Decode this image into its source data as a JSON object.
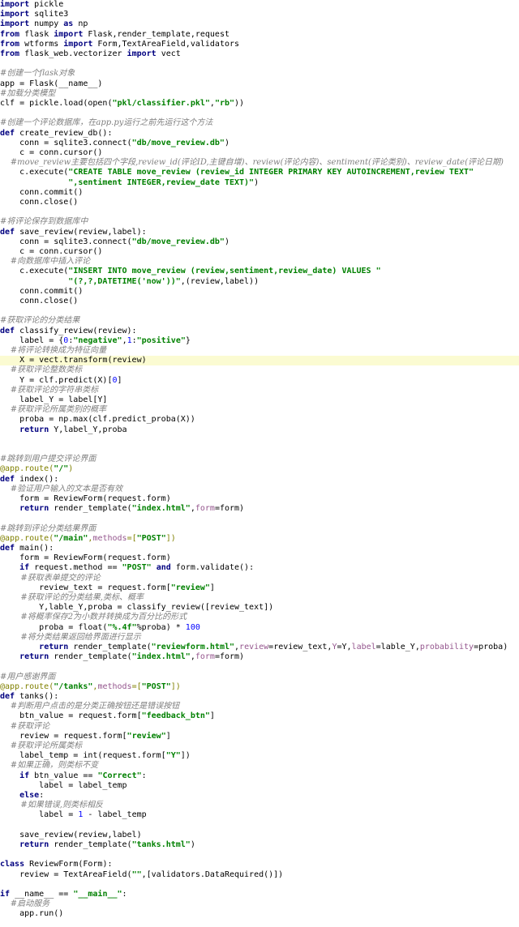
{
  "editor": {
    "highlighted_line_index": 36,
    "lines": [
      [
        [
          "k",
          "import"
        ],
        [
          "t",
          " pickle"
        ]
      ],
      [
        [
          "k",
          "import"
        ],
        [
          "t",
          " sqlite3"
        ]
      ],
      [
        [
          "k",
          "import"
        ],
        [
          "t",
          " numpy "
        ],
        [
          "k",
          "as"
        ],
        [
          "t",
          " np"
        ]
      ],
      [
        [
          "k",
          "from"
        ],
        [
          "t",
          " flask "
        ],
        [
          "k",
          "import"
        ],
        [
          "t",
          " Flask,render_template,request"
        ]
      ],
      [
        [
          "k",
          "from"
        ],
        [
          "t",
          " wtforms "
        ],
        [
          "k",
          "import"
        ],
        [
          "t",
          " Form,TextAreaField,validators"
        ]
      ],
      [
        [
          "k",
          "from"
        ],
        [
          "t",
          " flask_web.vectorizer "
        ],
        [
          "k",
          "import"
        ],
        [
          "t",
          " vect"
        ]
      ],
      [],
      [
        [
          "c",
          "#创建一个flask对象"
        ]
      ],
      [
        [
          "t",
          "app = Flask(__name__)"
        ]
      ],
      [
        [
          "c",
          "#加载分类模型"
        ]
      ],
      [
        [
          "t",
          "clf = pickle.load(open("
        ],
        [
          "s",
          "\"pkl/classifier.pkl\""
        ],
        [
          "t",
          ","
        ],
        [
          "s",
          "\"rb\""
        ],
        [
          "t",
          "))"
        ]
      ],
      [],
      [
        [
          "c",
          "#创建一个评论数据库，在app.py运行之前先运行这个方法"
        ]
      ],
      [
        [
          "k",
          "def"
        ],
        [
          "t",
          " create_review_db():"
        ]
      ],
      [
        [
          "t",
          "    conn = sqlite3.connect("
        ],
        [
          "s",
          "\"db/move_review.db\""
        ],
        [
          "t",
          ")"
        ]
      ],
      [
        [
          "t",
          "    c = conn.cursor()"
        ]
      ],
      [
        [
          "c",
          "    #move_review主要包括四个字段,review_id(评论ID,主键自增)、review(评论内容)、sentiment(评论类别)、review_date(评论日期)"
        ]
      ],
      [
        [
          "t",
          "    c.execute("
        ],
        [
          "s",
          "\"CREATE TABLE move_review (review_id INTEGER PRIMARY KEY AUTOINCREMENT,review TEXT\""
        ]
      ],
      [
        [
          "s",
          "              \",sentiment INTEGER,review_date TEXT)\""
        ],
        [
          "t",
          ")"
        ]
      ],
      [
        [
          "t",
          "    conn.commit()"
        ]
      ],
      [
        [
          "t",
          "    conn.close()"
        ]
      ],
      [],
      [
        [
          "c",
          "#将评论保存到数据库中"
        ]
      ],
      [
        [
          "k",
          "def"
        ],
        [
          "t",
          " save_review(review,label):"
        ]
      ],
      [
        [
          "t",
          "    conn = sqlite3.connect("
        ],
        [
          "s",
          "\"db/move_review.db\""
        ],
        [
          "t",
          ")"
        ]
      ],
      [
        [
          "t",
          "    c = conn.cursor()"
        ]
      ],
      [
        [
          "c",
          "    #向数据库中插入评论"
        ]
      ],
      [
        [
          "t",
          "    c.execute("
        ],
        [
          "s",
          "\"INSERT INTO move_review (review,sentiment,review_date) VALUES \""
        ]
      ],
      [
        [
          "s",
          "              \"(?,?,DATETIME('now'))\""
        ],
        [
          "t",
          ",(review,label))"
        ]
      ],
      [
        [
          "t",
          "    conn.commit()"
        ]
      ],
      [
        [
          "t",
          "    conn.close()"
        ]
      ],
      [],
      [
        [
          "c",
          "#获取评论的分类结果"
        ]
      ],
      [
        [
          "k",
          "def"
        ],
        [
          "t",
          " classify_review(review):"
        ]
      ],
      [
        [
          "t",
          "    label = {"
        ],
        [
          "n",
          "0"
        ],
        [
          "t",
          ":"
        ],
        [
          "s",
          "\"negative\""
        ],
        [
          "t",
          ","
        ],
        [
          "n",
          "1"
        ],
        [
          "t",
          ":"
        ],
        [
          "s",
          "\"positive\""
        ],
        [
          "t",
          "}"
        ]
      ],
      [
        [
          "c",
          "    #将评论转换成为特征向量"
        ]
      ],
      [
        [
          "t",
          "    X = vect.transform(review)"
        ]
      ],
      [
        [
          "c",
          "    #获取评论整数类标"
        ]
      ],
      [
        [
          "t",
          "    Y = clf.predict(X)["
        ],
        [
          "n",
          "0"
        ],
        [
          "t",
          "]"
        ]
      ],
      [
        [
          "c",
          "    #获取评论的字符串类标"
        ]
      ],
      [
        [
          "t",
          "    label_Y = label[Y]"
        ]
      ],
      [
        [
          "c",
          "    #获取评论所属类别的概率"
        ]
      ],
      [
        [
          "t",
          "    proba = np.max(clf.predict_proba(X))"
        ]
      ],
      [
        [
          "t",
          "    "
        ],
        [
          "k",
          "return"
        ],
        [
          "t",
          " Y,label_Y,proba"
        ]
      ],
      [],
      [],
      [
        [
          "c",
          "#跳转到用户提交评论界面"
        ]
      ],
      [
        [
          "d",
          "@app.route("
        ],
        [
          "s",
          "\"/\""
        ],
        [
          "d",
          ")"
        ]
      ],
      [
        [
          "k",
          "def"
        ],
        [
          "t",
          " index():"
        ]
      ],
      [
        [
          "c",
          "    #验证用户输入的文本是否有效"
        ]
      ],
      [
        [
          "t",
          "    form = ReviewForm(request.form)"
        ]
      ],
      [
        [
          "t",
          "    "
        ],
        [
          "k",
          "return"
        ],
        [
          "t",
          " render_template("
        ],
        [
          "s",
          "\"index.html\""
        ],
        [
          "t",
          ","
        ],
        [
          "v",
          "form"
        ],
        [
          "t",
          "=form)"
        ]
      ],
      [],
      [
        [
          "c",
          "#跳转到评论分类结果界面"
        ]
      ],
      [
        [
          "d",
          "@app.route("
        ],
        [
          "s",
          "\"/main\""
        ],
        [
          "d",
          ","
        ],
        [
          "v",
          "methods"
        ],
        [
          "d",
          "=["
        ],
        [
          "s",
          "\"POST\""
        ],
        [
          "d",
          "])"
        ]
      ],
      [
        [
          "k",
          "def"
        ],
        [
          "t",
          " main():"
        ]
      ],
      [
        [
          "t",
          "    form = ReviewForm(request.form)"
        ]
      ],
      [
        [
          "t",
          "    "
        ],
        [
          "k",
          "if"
        ],
        [
          "t",
          " request.method == "
        ],
        [
          "s",
          "\"POST\""
        ],
        [
          "t",
          " "
        ],
        [
          "k",
          "and"
        ],
        [
          "t",
          " form.validate():"
        ]
      ],
      [
        [
          "c",
          "        #获取表单提交的评论"
        ]
      ],
      [
        [
          "t",
          "        review_text = request.form["
        ],
        [
          "s",
          "\"review\""
        ],
        [
          "t",
          "]"
        ]
      ],
      [
        [
          "c",
          "        #获取评论的分类结果,类标、概率"
        ]
      ],
      [
        [
          "t",
          "        Y,lable_Y,proba = classify_review([review_text])"
        ]
      ],
      [
        [
          "c",
          "        #将概率保存2为小数并转换成为百分比的形式"
        ]
      ],
      [
        [
          "t",
          "        proba = float("
        ],
        [
          "s",
          "\"%.4f\""
        ],
        [
          "t",
          "%proba) * "
        ],
        [
          "n",
          "100"
        ]
      ],
      [
        [
          "c",
          "        #将分类结果返回给界面进行显示"
        ]
      ],
      [
        [
          "t",
          "        "
        ],
        [
          "k",
          "return"
        ],
        [
          "t",
          " render_template("
        ],
        [
          "s",
          "\"reviewform.html\""
        ],
        [
          "t",
          ","
        ],
        [
          "v",
          "review"
        ],
        [
          "t",
          "=review_text,"
        ],
        [
          "v",
          "Y"
        ],
        [
          "t",
          "=Y,"
        ],
        [
          "v",
          "label"
        ],
        [
          "t",
          "=lable_Y,"
        ],
        [
          "v",
          "probability"
        ],
        [
          "t",
          "=proba)"
        ]
      ],
      [
        [
          "t",
          "    "
        ],
        [
          "k",
          "return"
        ],
        [
          "t",
          " render_template("
        ],
        [
          "s",
          "\"index.html\""
        ],
        [
          "t",
          ","
        ],
        [
          "v",
          "form"
        ],
        [
          "t",
          "=form)"
        ]
      ],
      [],
      [
        [
          "c",
          "#用户感谢界面"
        ]
      ],
      [
        [
          "d",
          "@app.route("
        ],
        [
          "s",
          "\"/tanks\""
        ],
        [
          "d",
          ","
        ],
        [
          "v",
          "methods"
        ],
        [
          "d",
          "=["
        ],
        [
          "s",
          "\"POST\""
        ],
        [
          "d",
          "])"
        ]
      ],
      [
        [
          "k",
          "def"
        ],
        [
          "t",
          " tanks():"
        ]
      ],
      [
        [
          "c",
          "    #判断用户点击的是分类正确按钮还是错误按钮"
        ]
      ],
      [
        [
          "t",
          "    btn_value = request.form["
        ],
        [
          "s",
          "\"feedback_btn\""
        ],
        [
          "t",
          "]"
        ]
      ],
      [
        [
          "c",
          "    #获取评论"
        ]
      ],
      [
        [
          "t",
          "    review = request.form["
        ],
        [
          "s",
          "\"review\""
        ],
        [
          "t",
          "]"
        ]
      ],
      [
        [
          "c",
          "    #获取评论所属类标"
        ]
      ],
      [
        [
          "t",
          "    label_temp = int(request.form["
        ],
        [
          "s",
          "\"Y\""
        ],
        [
          "t",
          "])"
        ]
      ],
      [
        [
          "c",
          "    #如果正确，则类标不变"
        ]
      ],
      [
        [
          "t",
          "    "
        ],
        [
          "k",
          "if"
        ],
        [
          "t",
          " btn_value == "
        ],
        [
          "s",
          "\"Correct\""
        ],
        [
          "t",
          ":"
        ]
      ],
      [
        [
          "t",
          "        label = label_temp"
        ]
      ],
      [
        [
          "t",
          "    "
        ],
        [
          "k",
          "else"
        ],
        [
          "t",
          ":"
        ]
      ],
      [
        [
          "c",
          "        #如果错误,则类标相反"
        ]
      ],
      [
        [
          "t",
          "        label = "
        ],
        [
          "n",
          "1"
        ],
        [
          "t",
          " - label_temp"
        ]
      ],
      [],
      [
        [
          "t",
          "    save_review(review,label)"
        ]
      ],
      [
        [
          "t",
          "    "
        ],
        [
          "k",
          "return"
        ],
        [
          "t",
          " render_template("
        ],
        [
          "s",
          "\"tanks.html\""
        ],
        [
          "t",
          ")"
        ]
      ],
      [],
      [
        [
          "k",
          "class"
        ],
        [
          "t",
          " ReviewForm(Form):"
        ]
      ],
      [
        [
          "t",
          "    review = TextAreaField("
        ],
        [
          "s",
          "\"\""
        ],
        [
          "t",
          ",[validators.DataRequired()])"
        ]
      ],
      [],
      [
        [
          "k",
          "if"
        ],
        [
          "t",
          " __name__ == "
        ],
        [
          "s",
          "\"__main__\""
        ],
        [
          "t",
          ":"
        ]
      ],
      [
        [
          "c",
          "    #启动服务"
        ]
      ],
      [
        [
          "t",
          "    app.run()"
        ]
      ]
    ]
  }
}
